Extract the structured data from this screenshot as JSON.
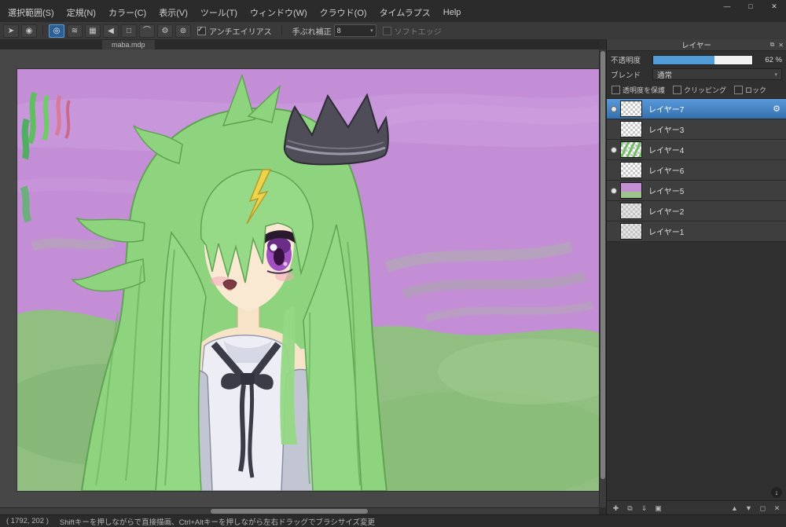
{
  "menu_bar": {
    "items": [
      "選択範囲(S)",
      "定規(N)",
      "カラー(C)",
      "表示(V)",
      "ツール(T)",
      "ウィンドウ(W)",
      "クラウド(O)",
      "タイムラプス",
      "Help"
    ]
  },
  "window_controls": {
    "minimize": "—",
    "maximize": "□",
    "close": "✕"
  },
  "toolbar": {
    "pointer_glyph": "➤",
    "brush_preview_glyph": "◉",
    "tools": [
      {
        "id": "snap-off",
        "glyph": "◎",
        "active": true
      },
      {
        "id": "snap-parallel",
        "glyph": "≋",
        "active": false
      },
      {
        "id": "snap-grid",
        "glyph": "▦",
        "active": false
      },
      {
        "id": "snap-vanishing-point",
        "glyph": "◀",
        "active": false
      },
      {
        "id": "snap-rect",
        "glyph": "□",
        "active": false
      },
      {
        "id": "snap-curve",
        "glyph": "⌒",
        "active": false
      },
      {
        "id": "snap-settings",
        "glyph": "⚙",
        "active": false
      },
      {
        "id": "snap-extra",
        "glyph": "⊚",
        "active": false
      }
    ],
    "antialias": {
      "label": "アンチエイリアス",
      "checked": true
    },
    "stabilizer_label": "手ぶれ補正",
    "stabilizer_value": "8",
    "softedge": {
      "label": "ソフトエッジ",
      "checked": false
    },
    "dropdown_arrow": "▾"
  },
  "document_tab": {
    "title": "maba.mdp"
  },
  "layers_panel": {
    "title": "レイヤー",
    "header_icons": [
      {
        "id": "float-panel",
        "glyph": "⧉"
      },
      {
        "id": "close-panel",
        "glyph": "✕"
      }
    ],
    "opacity_label": "不透明度",
    "opacity_percent": 62,
    "opacity_value": "62 %",
    "blend_label": "ブレンド",
    "blend_value": "通常",
    "options": [
      {
        "label": "透明度を保護",
        "checked": false
      },
      {
        "label": "クリッピング",
        "checked": false
      },
      {
        "label": "ロック",
        "checked": false
      }
    ],
    "layers": [
      {
        "name": "レイヤー7",
        "visible": true,
        "selected": true,
        "thumb": "checker"
      },
      {
        "name": "レイヤー3",
        "visible": false,
        "selected": false,
        "thumb": "checker"
      },
      {
        "name": "レイヤー4",
        "visible": true,
        "selected": false,
        "thumb": "green"
      },
      {
        "name": "レイヤー6",
        "visible": false,
        "selected": false,
        "thumb": "checker"
      },
      {
        "name": "レイヤー5",
        "visible": true,
        "selected": false,
        "thumb": "purple"
      },
      {
        "name": "レイヤー2",
        "visible": false,
        "selected": false,
        "thumb": "faint"
      },
      {
        "name": "レイヤー1",
        "visible": false,
        "selected": false,
        "thumb": "faint"
      }
    ],
    "selected_layer_gear_glyph": "⚙",
    "footer_icons": [
      {
        "id": "add-layer",
        "glyph": "✚"
      },
      {
        "id": "duplicate-layer",
        "glyph": "⧉"
      },
      {
        "id": "merge-layer",
        "glyph": "⇓"
      },
      {
        "id": "add-folder",
        "glyph": "▣"
      },
      {
        "id": "move-layer-up",
        "glyph": "▲"
      },
      {
        "id": "move-layer-down",
        "glyph": "▼"
      },
      {
        "id": "clear-layer",
        "glyph": "◻"
      },
      {
        "id": "delete-layer",
        "glyph": "✕"
      }
    ],
    "scroll_bottom_glyph": "↓"
  },
  "status_bar": {
    "coordinates": "( 1792, 202 )",
    "hint": "Shiftキーを押しながらで直接描画、Ctrl+Altキーを押しながら左右ドラッグでブラシサイズ変更"
  }
}
